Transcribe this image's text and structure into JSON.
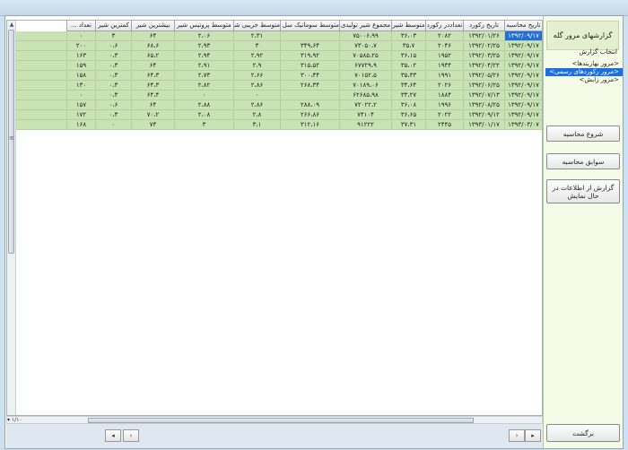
{
  "sidebar": {
    "title": "گزارشهای مرور گله",
    "report_label": "انتخاب گزارش",
    "reports": [
      "<مرور بهاربندها>",
      "<مرور رکوردهای رسمی>",
      "<مرور زایش>"
    ],
    "selected_report_index": 1,
    "start_button": "شروع محاسبه",
    "history_button": "سوابق محاسبه",
    "report_current_button": "گزارش از اطلاعات در حال نمایش",
    "back_button": "برگشت"
  },
  "grid": {
    "columns": [
      "تاریخ محاسبه",
      "تاریخ رکورد",
      "تعداددر رکورد",
      "متوسط شیر",
      "مجموع شیر تولیدی",
      "متوسط سوماتیک سل کانت",
      "متوسط جریبی شیر",
      "متوسط پروتیس شیر",
      "بیشترین شیر",
      "کمترین شیر",
      "تعداد ..."
    ],
    "rows": [
      [
        "۱۳۹۲/۰۹/۱۷",
        "۱۳۹۲/۰۱/۲۶",
        "۲۰۸۲",
        "۳۶،۰۳",
        "۷۵۰۰۶،۹۹",
        "",
        "۲،۳۱",
        "۲،۰۶",
        "۶۴",
        "۳",
        "۰"
      ],
      [
        "۱۳۹۲/۰۹/۱۷",
        "۱۳۹۲/۰۲/۲۵",
        "۲۰۴۶",
        "۳۵،۷",
        "۷۳۰۵۰،۷",
        "۳۴۹،۶۴",
        "۳",
        "۲،۹۳",
        "۶۸،۶",
        "۰،۶",
        "۲۰۰"
      ],
      [
        "۱۳۹۲/۰۹/۱۷",
        "۱۳۹۲/۰۳/۲۵",
        "۱۹۵۲",
        "۳۶،۱۵",
        "۷۰۵۸۵،۲۵",
        "۳۱۹،۹۲",
        "۲،۹۲",
        "۲،۹۴",
        "۶۵،۲",
        "۰،۳",
        "۱۶۳"
      ],
      [
        "۱۳۹۲/۰۹/۱۷",
        "۱۳۹۲/۰۴/۲۲",
        "۱۹۳۴",
        "۳۵،۰۲",
        "۶۷۷۲۹،۹",
        "۳۱۵،۵۲",
        "۲،۹",
        "۲،۹۱",
        "۶۴",
        "۰،۳",
        "۱۵۹"
      ],
      [
        "۱۳۹۲/۰۹/۱۷",
        "۱۳۹۲/۰۵/۲۶",
        "۱۹۹۱",
        "۳۵،۳۳",
        "۷۰۱۵۲،۵",
        "۳۰۰،۴۴",
        "۲،۶۶",
        "۲،۷۳",
        "۶۴،۳",
        "۰،۳",
        "۱۵۸"
      ],
      [
        "۱۳۹۲/۰۹/۱۷",
        "۱۳۹۲/۰۶/۲۵",
        "۲۰۲۶",
        "۳۴،۶۴",
        "۷۰۱۸۹،۰۶",
        "۲۶۸،۳۴",
        "۲،۸۶",
        "۲،۸۲",
        "۶۴،۳",
        "۰،۳",
        "۱۳۰"
      ],
      [
        "۱۳۹۲/۰۹/۱۷",
        "۱۳۹۲/۰۷/۱۳",
        "۱۸۸۴",
        "۳۳،۲۷",
        "۶۲۶۸۵،۹۸",
        "",
        "۰",
        "۰",
        "۶۴،۴",
        "۰،۳",
        "۰"
      ],
      [
        "۱۳۹۲/۰۹/۱۷",
        "۱۳۹۲/۰۸/۲۵",
        "۱۹۹۶",
        "۳۶،۰۸",
        "۷۲۰۲۲،۲",
        "۲۸۸،۰۹",
        "۲،۸۶",
        "۲،۸۸",
        "۶۴",
        "۰،۶",
        "۱۵۷"
      ],
      [
        "۱۳۹۲/۰۹/۱۷",
        "۱۳۹۲/۰۹/۱۲",
        "۲۰۲۲",
        "۳۶،۶۵",
        "۷۴۱۰۴",
        "۲۶۶،۸۶",
        "۲،۸",
        "۲،۰۸",
        "۷۰،۲",
        "۰،۳",
        "۱۷۲"
      ],
      [
        "۱۳۹۳/۰۳/۰۷",
        "۱۳۹۳/۰۱/۱۷",
        "۲۴۴۵",
        "۳۷،۳۱",
        "۹۱۲۲۲",
        "۳۱۲،۱۶",
        "۳،۱",
        "۳",
        "۷۳",
        "۰",
        "۱۶۸"
      ]
    ],
    "selected_cell": [
      0,
      0
    ],
    "pager": "۱/۱۰"
  }
}
